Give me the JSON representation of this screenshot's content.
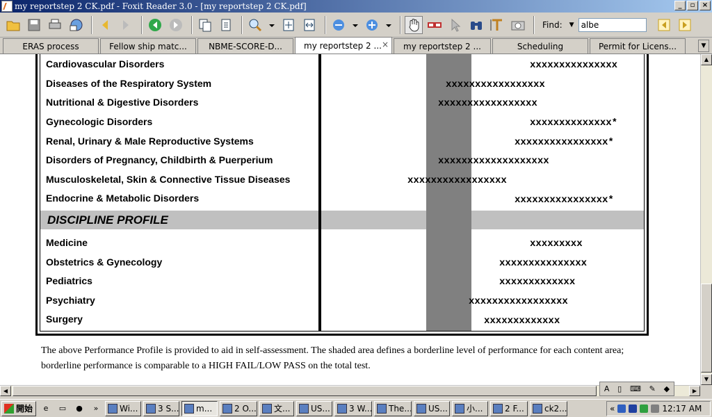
{
  "window": {
    "title": "my reportstep 2 CK.pdf - Foxit Reader 3.0 - [my reportstep 2 CK.pdf]",
    "min_symbol": "_",
    "max_symbol": "▫",
    "close_symbol": "×"
  },
  "toolbar": {
    "find_label": "Find:",
    "find_dropdown": "▼",
    "find_value": "albe",
    "icons": [
      "open-folder-icon",
      "save-icon",
      "print-icon",
      "email-icon",
      "back-arrow-icon",
      "forward-arrow-icon",
      "go-back-icon",
      "go-forward-icon",
      "copy-page-icon",
      "paste-page-icon",
      "zoom-in-icon",
      "fit-page-icon",
      "fit-width-icon",
      "zoom-out-icon",
      "zoom-plus-icon",
      "hand-tool-icon",
      "reading-glasses-icon",
      "select-icon",
      "binoculars-icon",
      "text-select-icon",
      "snapshot-icon",
      "find-prev-icon",
      "find-next-icon"
    ]
  },
  "tabs": [
    {
      "label": "ERAS process",
      "active": false
    },
    {
      "label": "Fellow ship matc...",
      "active": false
    },
    {
      "label": "NBME-SCORE-D...",
      "active": false
    },
    {
      "label": "my reportstep 2 ...",
      "active": true,
      "close": "×"
    },
    {
      "label": "my reportstep 2 ...",
      "active": false
    },
    {
      "label": "Scheduling",
      "active": false
    },
    {
      "label": "Permit for Licens...",
      "active": false
    }
  ],
  "tabs_more": "▼",
  "report": {
    "content_rows": [
      {
        "label": "Cardiovascular Disorders",
        "bar": "xxxxxxxxxxxxxxx"
      },
      {
        "label": "Diseases of the Respiratory System",
        "bar": "xxxxxxxxxxxxxxxxx"
      },
      {
        "label": "Nutritional & Digestive Disorders",
        "bar": "xxxxxxxxxxxxxxxxx"
      },
      {
        "label": "Gynecologic Disorders",
        "bar": "xxxxxxxxxxxxxx*"
      },
      {
        "label": "Renal, Urinary & Male Reproductive Systems",
        "bar": "xxxxxxxxxxxxxxxx*"
      },
      {
        "label": "Disorders of Pregnancy, Childbirth & Puerperium",
        "bar": "xxxxxxxxxxxxxxxxxxx"
      },
      {
        "label": "Musculoskeletal, Skin & Connective Tissue Diseases",
        "bar": "xxxxxxxxxxxxxxxxx"
      },
      {
        "label": "Endocrine & Metabolic Disorders",
        "bar": "xxxxxxxxxxxxxxxx*"
      }
    ],
    "discipline_title": "DISCIPLINE PROFILE",
    "discipline_rows": [
      {
        "label": "Medicine",
        "bar": "xxxxxxxxx"
      },
      {
        "label": "Obstetrics & Gynecology",
        "bar": "xxxxxxxxxxxxxxx"
      },
      {
        "label": "Pediatrics",
        "bar": "xxxxxxxxxxxxx"
      },
      {
        "label": "Psychiatry",
        "bar": "xxxxxxxxxxxxxxxxx"
      },
      {
        "label": "Surgery",
        "bar": "xxxxxxxxxxxxx"
      }
    ],
    "footnote": "The above Performance Profile is provided to aid in self-assessment. The shaded area defines a borderline level of performance for each content area; borderline performance is comparable to a HIGH FAIL/LOW PASS on the total test."
  },
  "taskbar": {
    "start_label": "開始",
    "quick_launch_more": "»",
    "tasks": [
      {
        "label": "Wi...",
        "active": false
      },
      {
        "label": "3 S...",
        "active": false
      },
      {
        "label": "m...",
        "active": true
      },
      {
        "label": "2 O...",
        "active": false
      },
      {
        "label": "文...",
        "active": false
      },
      {
        "label": "US...",
        "active": false
      },
      {
        "label": "3 W...",
        "active": false
      },
      {
        "label": "The...",
        "active": false
      },
      {
        "label": "US...",
        "active": false
      },
      {
        "label": "小...",
        "active": false
      },
      {
        "label": "2 F...",
        "active": false
      },
      {
        "label": "ck2...",
        "active": false
      }
    ],
    "tray_more": "«",
    "clock": "12:17 AM"
  }
}
